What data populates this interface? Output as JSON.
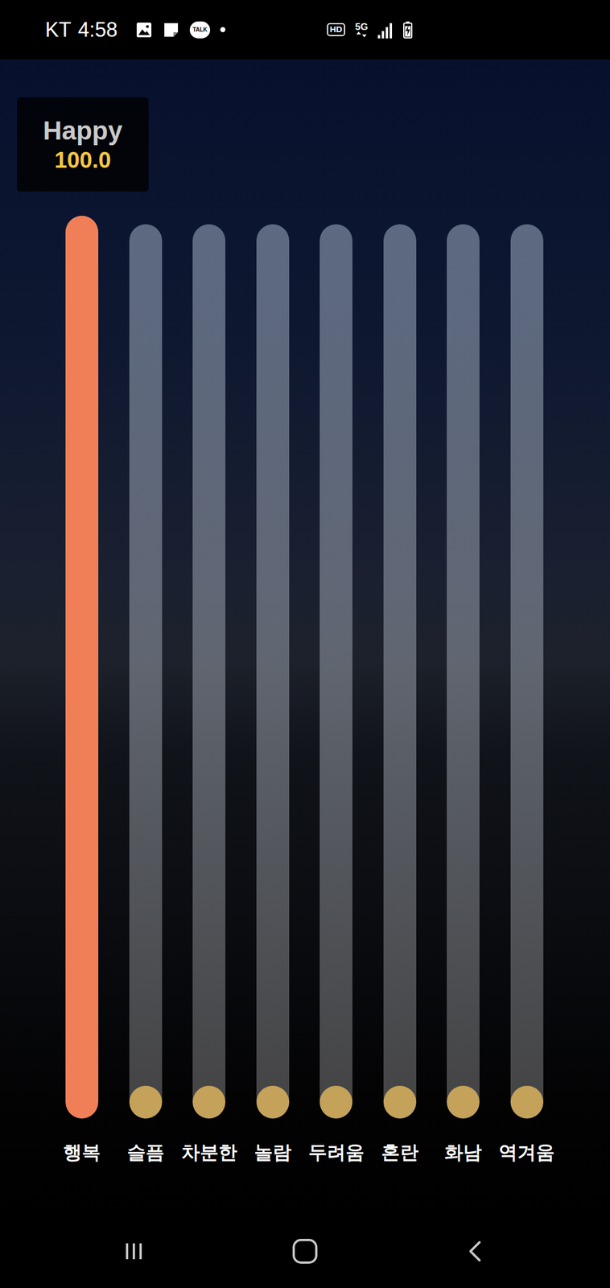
{
  "status_bar": {
    "carrier": "KT",
    "time": "4:58",
    "notifications": [
      {
        "kind": "image"
      },
      {
        "kind": "note"
      },
      {
        "kind": "talk",
        "label": "TALK"
      },
      {
        "kind": "dot"
      }
    ],
    "hd": "HD",
    "network": "5G",
    "signal": {
      "level": 1
    },
    "battery": {
      "level": 0.85,
      "charging": true
    }
  },
  "readout": {
    "title": "Happy",
    "value": "100.0"
  },
  "sliders": [
    {
      "label": "행복",
      "level": 1,
      "selected": true
    },
    {
      "label": "슬픔",
      "level": 0,
      "selected": false
    },
    {
      "label": "차분한",
      "level": 0,
      "selected": false
    },
    {
      "label": "놀람",
      "level": 0,
      "selected": false
    },
    {
      "label": "두려움",
      "level": 0,
      "selected": false
    },
    {
      "label": "혼란",
      "level": 0,
      "selected": false
    },
    {
      "label": "화남",
      "level": 0,
      "selected": false
    },
    {
      "label": "역겨움",
      "level": 0,
      "selected": false
    }
  ],
  "nav_bar": [
    {
      "kind": "recents"
    },
    {
      "kind": "home"
    },
    {
      "kind": "back"
    }
  ]
}
